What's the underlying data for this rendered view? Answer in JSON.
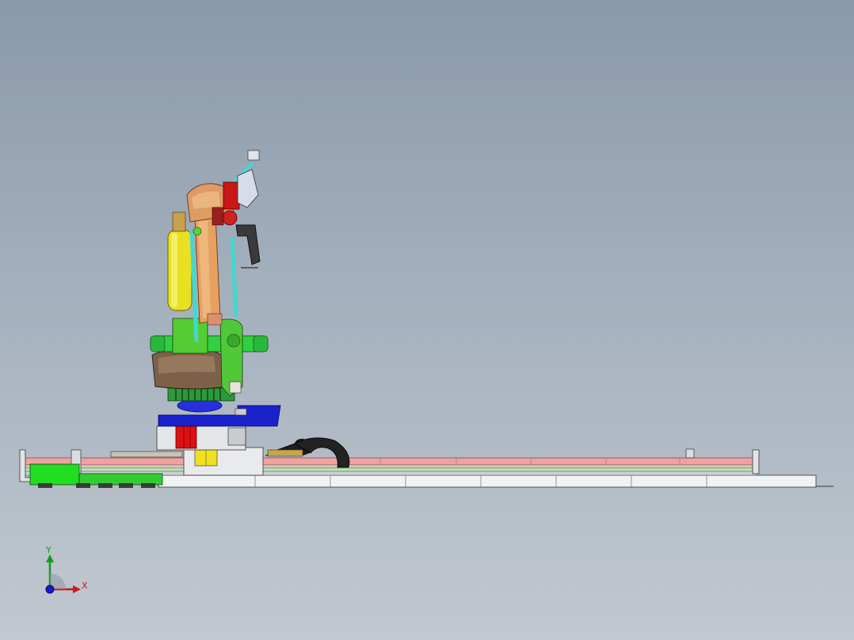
{
  "viewport": {
    "background_top": "#8a99aa",
    "background_bottom": "#c2c8cf"
  },
  "model": {
    "subject": "robot-on-linear-track-cad-view",
    "part_colors": {
      "track_rail": "#f2a0a0",
      "track_base": "#f0f2f4",
      "carriage_green": "#22dd22",
      "turntable_blue": "#1a22cc",
      "base_joint_green": "#44cc33",
      "base_housing": "#8a6e52",
      "arm_orange": "#e8a060",
      "forearm_pink": "#d89070",
      "counterweight_cylinder": "#e8e020",
      "link_rod_cyan": "#40d8d0",
      "wrist_red": "#c81818",
      "motor_red": "#dd1111",
      "junction_box_yellow": "#f0e020",
      "cable_chain": "#202020"
    }
  },
  "triad": {
    "x_label": "X",
    "y_label": "Y",
    "x_color": "#d01818",
    "y_color": "#0aa01a",
    "z_color": "#1818d0"
  }
}
